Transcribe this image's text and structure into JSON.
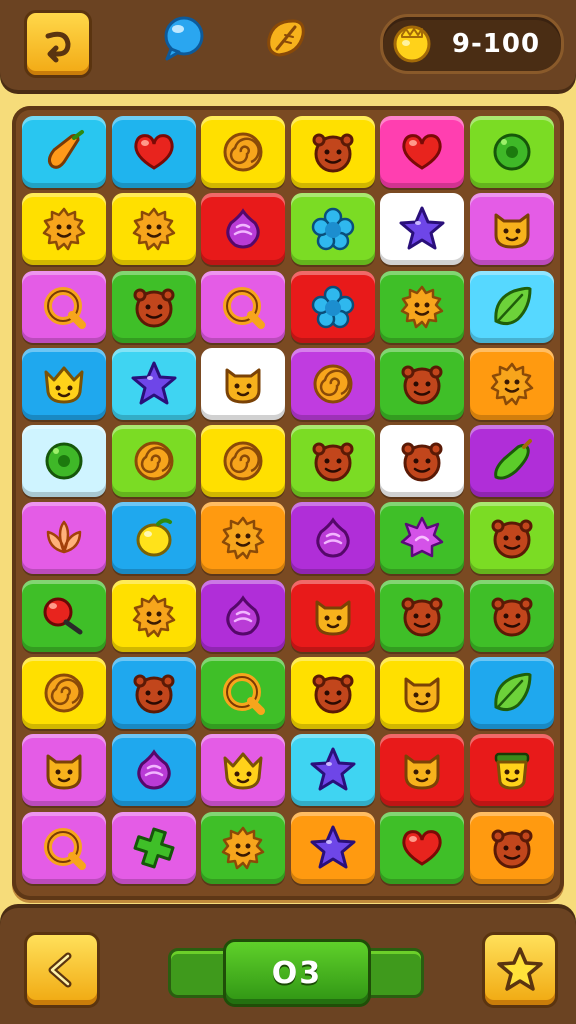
{
  "top_bar": {
    "menu_icon": "curl-arrow-icon",
    "bubble_icon": "speech-bubble-icon",
    "leaf_icon": "leaf-icon",
    "coin_icon": "gold-coin-icon",
    "score": "9-100"
  },
  "board": {
    "columns": 6,
    "rows": [
      [
        {
          "bg": "#29c6f0",
          "icon": "carrot-icon"
        },
        {
          "bg": "#1fb4ee",
          "icon": "heart-icon"
        },
        {
          "bg": "#ffe000",
          "icon": "swirl-icon"
        },
        {
          "bg": "#ffe000",
          "icon": "monster-icon"
        },
        {
          "bg": "#ff3fb0",
          "icon": "heart-icon"
        },
        {
          "bg": "#7bdc24",
          "icon": "donut-icon"
        }
      ],
      [
        {
          "bg": "#ffe000",
          "icon": "sun-face-icon"
        },
        {
          "bg": "#ffe000",
          "icon": "sun-face-icon"
        },
        {
          "bg": "#e81a1a",
          "icon": "onion-icon"
        },
        {
          "bg": "#7bdc24",
          "icon": "flower-icon"
        },
        {
          "bg": "#ffffff",
          "icon": "star-icon"
        },
        {
          "bg": "#e45ce6",
          "icon": "cat-face-icon"
        }
      ],
      [
        {
          "bg": "#e45ce6",
          "icon": "ring-icon"
        },
        {
          "bg": "#3fbf28",
          "icon": "monster-icon"
        },
        {
          "bg": "#e45ce6",
          "icon": "ring-icon"
        },
        {
          "bg": "#e81a1a",
          "icon": "flower-icon"
        },
        {
          "bg": "#3fbf28",
          "icon": "sun-face-icon"
        },
        {
          "bg": "#56d8ff",
          "icon": "leaf-icon"
        }
      ],
      [
        {
          "bg": "#1fa8ee",
          "icon": "crown-face-icon"
        },
        {
          "bg": "#3fd4f2",
          "icon": "star-icon"
        },
        {
          "bg": "#ffffff",
          "icon": "cat-face-icon"
        },
        {
          "bg": "#c03ce0",
          "icon": "swirl-icon"
        },
        {
          "bg": "#3fbf28",
          "icon": "monster-icon"
        },
        {
          "bg": "#ff9a10",
          "icon": "sun-face-icon"
        }
      ],
      [
        {
          "bg": "#cff4ff",
          "icon": "donut-icon"
        },
        {
          "bg": "#7bdc24",
          "icon": "swirl-icon"
        },
        {
          "bg": "#ffe000",
          "icon": "swirl-icon"
        },
        {
          "bg": "#7bdc24",
          "icon": "monster-icon"
        },
        {
          "bg": "#ffffff",
          "icon": "monster-icon"
        },
        {
          "bg": "#b02ed8",
          "icon": "pepper-icon"
        }
      ],
      [
        {
          "bg": "#e45ce6",
          "icon": "lotus-icon"
        },
        {
          "bg": "#1fa8ee",
          "icon": "lemon-icon"
        },
        {
          "bg": "#ff9a10",
          "icon": "sun-face-icon"
        },
        {
          "bg": "#b02ed8",
          "icon": "onion-icon"
        },
        {
          "bg": "#3fbf28",
          "icon": "spiky-icon"
        },
        {
          "bg": "#7bdc24",
          "icon": "monster-icon"
        }
      ],
      [
        {
          "bg": "#3fbf28",
          "icon": "cherry-icon"
        },
        {
          "bg": "#ffe000",
          "icon": "sun-face-icon"
        },
        {
          "bg": "#b02ed8",
          "icon": "onion-icon"
        },
        {
          "bg": "#e81a1a",
          "icon": "cat-face-icon"
        },
        {
          "bg": "#3fbf28",
          "icon": "monster-icon"
        },
        {
          "bg": "#3fbf28",
          "icon": "monster-icon"
        }
      ],
      [
        {
          "bg": "#ffe000",
          "icon": "swirl-icon"
        },
        {
          "bg": "#1fa8ee",
          "icon": "monster-icon"
        },
        {
          "bg": "#3fbf28",
          "icon": "ring-icon"
        },
        {
          "bg": "#ffe000",
          "icon": "monster-icon"
        },
        {
          "bg": "#ffe000",
          "icon": "cat-face-icon"
        },
        {
          "bg": "#1fa8ee",
          "icon": "leaf-icon"
        }
      ],
      [
        {
          "bg": "#e45ce6",
          "icon": "cat-face-icon"
        },
        {
          "bg": "#1fa8ee",
          "icon": "onion-icon"
        },
        {
          "bg": "#e45ce6",
          "icon": "crown-face-icon"
        },
        {
          "bg": "#3fd4f2",
          "icon": "star-icon"
        },
        {
          "bg": "#e81a1a",
          "icon": "cat-face-icon"
        },
        {
          "bg": "#e81a1a",
          "icon": "pot-face-icon"
        }
      ],
      [
        {
          "bg": "#e45ce6",
          "icon": "ring-icon"
        },
        {
          "bg": "#e45ce6",
          "icon": "cross-icon"
        },
        {
          "bg": "#3fbf28",
          "icon": "sun-face-icon"
        },
        {
          "bg": "#ff9a10",
          "icon": "star-icon"
        },
        {
          "bg": "#3fbf28",
          "icon": "heart-icon"
        },
        {
          "bg": "#ff9a10",
          "icon": "monster-icon"
        }
      ]
    ]
  },
  "bottom_bar": {
    "back_icon": "chevron-left-icon",
    "level": "O3",
    "star_icon": "star-icon"
  }
}
